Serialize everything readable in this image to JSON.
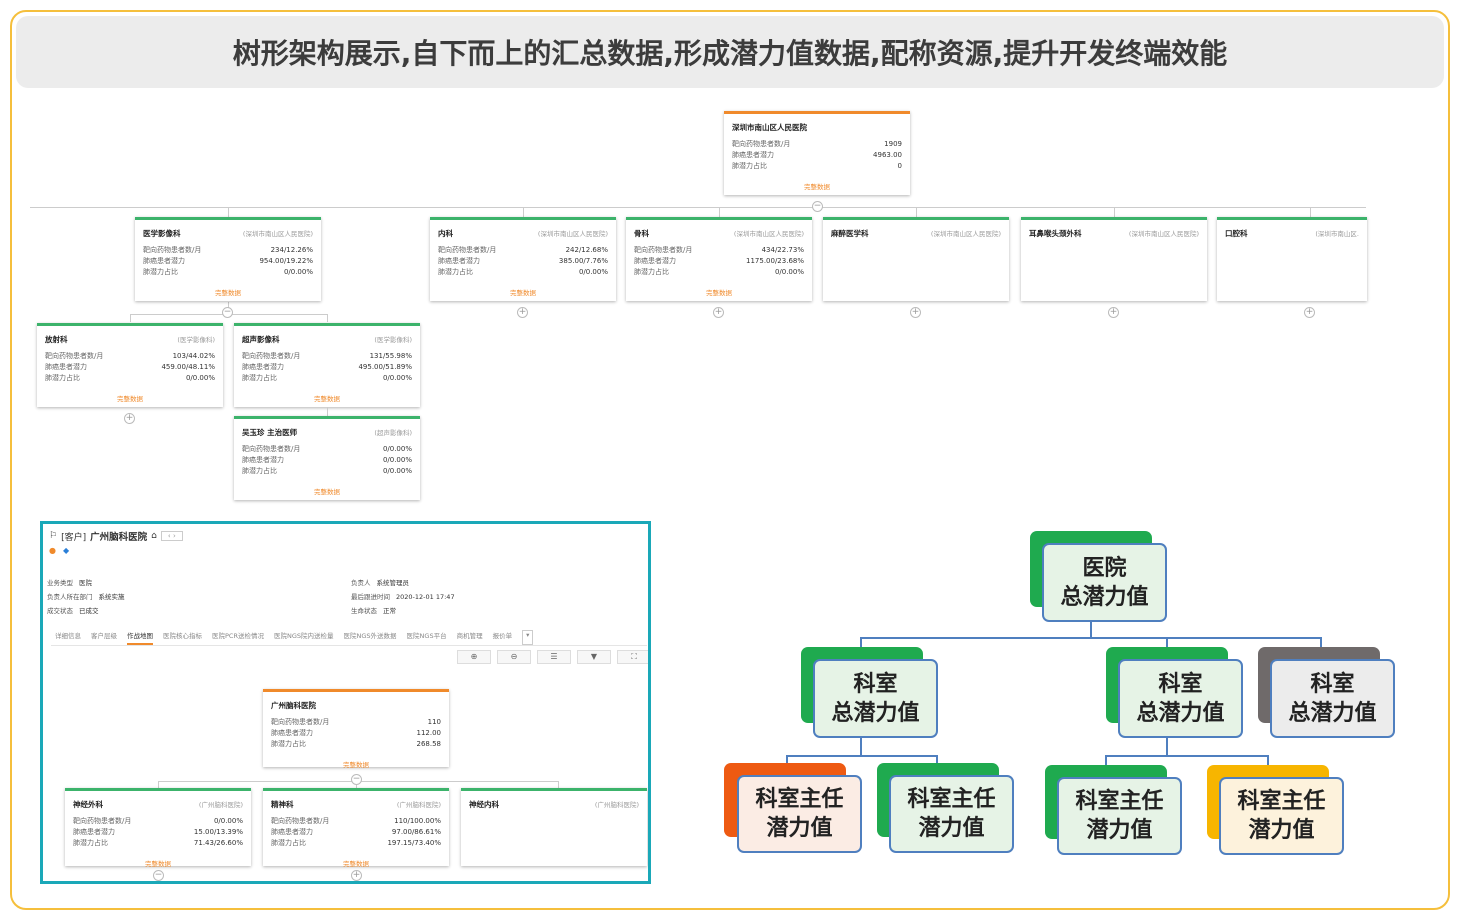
{
  "banner": {
    "title": "树形架构展示,自下而上的汇总数据,形成潜力值数据,配称资源,提升开发终端效能"
  },
  "tree": {
    "root": {
      "name": "深圳市南山区人民医院",
      "rows": [
        {
          "label": "靶向药物患者数/月",
          "value": "1909"
        },
        {
          "label": "肺癌患者潜力",
          "value": "4963.00"
        },
        {
          "label": "肺潜力占比",
          "value": "0"
        }
      ],
      "more": "完整数据"
    },
    "depts": [
      {
        "name": "医学影像科",
        "context": "(深圳市南山区人民医院)",
        "rows": [
          {
            "label": "靶向药物患者数/月",
            "value": "234/12.26%"
          },
          {
            "label": "肺癌患者潜力",
            "value": "954.00/19.22%"
          },
          {
            "label": "肺潜力占比",
            "value": "0/0.00%"
          }
        ],
        "more": "完整数据"
      },
      {
        "name": "内科",
        "context": "(深圳市南山区人民医院)",
        "rows": [
          {
            "label": "靶向药物患者数/月",
            "value": "242/12.68%"
          },
          {
            "label": "肺癌患者潜力",
            "value": "385.00/7.76%"
          },
          {
            "label": "肺潜力占比",
            "value": "0/0.00%"
          }
        ],
        "more": "完整数据"
      },
      {
        "name": "骨科",
        "context": "(深圳市南山区人民医院)",
        "rows": [
          {
            "label": "靶向药物患者数/月",
            "value": "434/22.73%"
          },
          {
            "label": "肺癌患者潜力",
            "value": "1175.00/23.68%"
          },
          {
            "label": "肺潜力占比",
            "value": "0/0.00%"
          }
        ],
        "more": "完整数据"
      },
      {
        "name": "麻醉医学科",
        "context": "(深圳市南山区人民医院)",
        "rows": [],
        "more": ""
      },
      {
        "name": "耳鼻喉头颈外科",
        "context": "(深圳市南山区人民医院)",
        "rows": [],
        "more": ""
      },
      {
        "name": "口腔科",
        "context": "(深圳市南山区.",
        "rows": [],
        "more": ""
      }
    ],
    "subs": [
      {
        "name": "放射科",
        "context": "(医学影像科)",
        "rows": [
          {
            "label": "靶向药物患者数/月",
            "value": "103/44.02%"
          },
          {
            "label": "肺癌患者潜力",
            "value": "459.00/48.11%"
          },
          {
            "label": "肺潜力占比",
            "value": "0/0.00%"
          }
        ],
        "more": "完整数据"
      },
      {
        "name": "超声影像科",
        "context": "(医学影像科)",
        "rows": [
          {
            "label": "靶向药物患者数/月",
            "value": "131/55.98%"
          },
          {
            "label": "肺癌患者潜力",
            "value": "495.00/51.89%"
          },
          {
            "label": "肺潜力占比",
            "value": "0/0.00%"
          }
        ],
        "more": "完整数据"
      },
      {
        "name": "吴玉珍 主治医师",
        "context": "(超声影像科)",
        "rows": [
          {
            "label": "靶向药物患者数/月",
            "value": "0/0.00%"
          },
          {
            "label": "肺癌患者潜力",
            "value": "0/0.00%"
          },
          {
            "label": "肺潜力占比",
            "value": "0/0.00%"
          }
        ],
        "more": "完整数据"
      }
    ],
    "toggle_minus": "−",
    "toggle_plus": "+"
  },
  "crm": {
    "tag": "[客户]",
    "hospital": "广州脑科医院",
    "nav_prev": "‹",
    "nav_next": "›",
    "fields": [
      {
        "label": "业务类型",
        "value": "医院"
      },
      {
        "label": "负责人所在部门",
        "value": "系统实施"
      },
      {
        "label": "成交状态",
        "value": "已成交"
      },
      {
        "label": "负责人",
        "value": "系统管理员"
      },
      {
        "label": "最后跟进时间",
        "value": "2020-12-01 17:47"
      },
      {
        "label": "生命状态",
        "value": "正常"
      }
    ],
    "tabs": [
      "详细信息",
      "客户层级",
      "作战地图",
      "医院核心指标",
      "医院PCR送检情况",
      "医院NGS院内送检量",
      "医院NGS外送数据",
      "医院NGS平台",
      "商机管理",
      "报价单"
    ],
    "active_tab": "作战地图",
    "tab_more": "▾",
    "root": {
      "name": "广州脑科医院",
      "rows": [
        {
          "label": "靶向药物患者数/月",
          "value": "110"
        },
        {
          "label": "肺癌患者潜力",
          "value": "112.00"
        },
        {
          "label": "肺潜力占比",
          "value": "268.58"
        }
      ],
      "more": "完整数据"
    },
    "depts": [
      {
        "name": "神经外科",
        "context": "(广州脑科医院)",
        "rows": [
          {
            "label": "靶向药物患者数/月",
            "value": "0/0.00%"
          },
          {
            "label": "肺癌患者潜力",
            "value": "15.00/13.39%"
          },
          {
            "label": "肺潜力占比",
            "value": "71.43/26.60%"
          }
        ],
        "more": "完整数据"
      },
      {
        "name": "精神科",
        "context": "(广州脑科医院)",
        "rows": [
          {
            "label": "靶向药物患者数/月",
            "value": "110/100.00%"
          },
          {
            "label": "肺癌患者潜力",
            "value": "97.00/86.61%"
          },
          {
            "label": "肺潜力占比",
            "value": "197.15/73.40%"
          }
        ],
        "more": "完整数据"
      },
      {
        "name": "神经内科",
        "context": "(广州脑科医院)",
        "rows": [],
        "more": ""
      }
    ]
  },
  "pyramid": {
    "top": {
      "line1": "医院",
      "line2": "总潜力值",
      "accent": "#1faa4f"
    },
    "mid": [
      {
        "line1": "科室",
        "line2": "总潜力值",
        "accent": "#1faa4f"
      },
      {
        "line1": "科室",
        "line2": "总潜力值",
        "accent": "#1faa4f"
      },
      {
        "line1": "科室",
        "line2": "总潜力值",
        "accent": "#6f6a6a"
      }
    ],
    "leaf": [
      {
        "line1": "科室主任",
        "line2": "潜力值",
        "accent": "#ee5a12"
      },
      {
        "line1": "科室主任",
        "line2": "潜力值",
        "accent": "#1faa4f"
      },
      {
        "line1": "科室主任",
        "line2": "潜力值",
        "accent": "#1faa4f"
      },
      {
        "line1": "科室主任",
        "line2": "潜力值",
        "accent": "#f7b500"
      }
    ]
  }
}
